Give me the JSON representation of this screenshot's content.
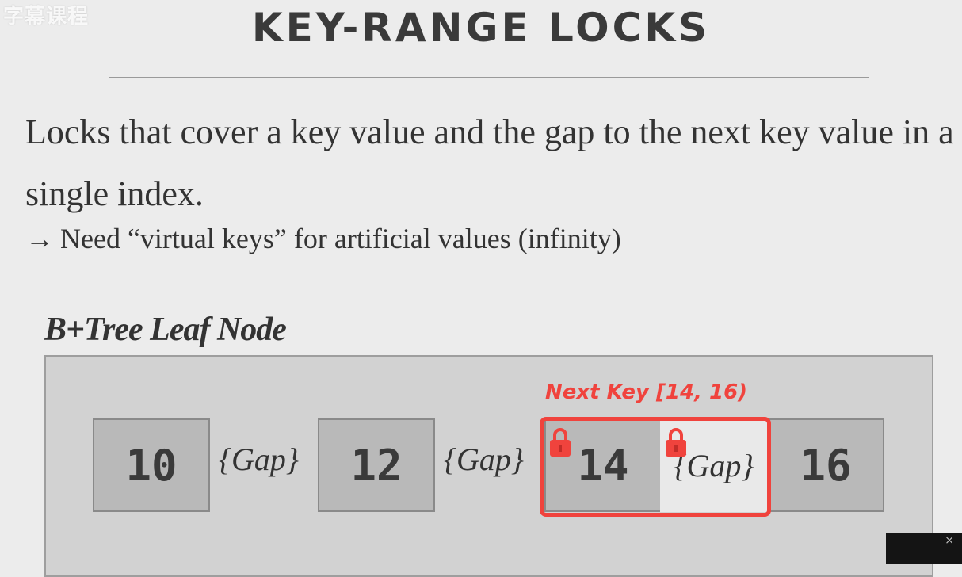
{
  "watermark": "字幕课程",
  "slide": {
    "title": "KEY-RANGE LOCKS",
    "body": "Locks that cover a key value and the gap to the next key value in a single index.",
    "bullet_arrow": "→",
    "bullet": "Need “virtual keys” for artificial values (infinity)"
  },
  "diagram": {
    "label": "B+Tree Leaf Node",
    "keys": [
      "10",
      "12",
      "14",
      "16"
    ],
    "gap_text": "{Gap}",
    "highlight_label": "Next Key [14, 16)",
    "highlight_color": "#f0433d",
    "lock_icon": "lock-icon"
  },
  "player": {
    "close_glyph": "×"
  }
}
